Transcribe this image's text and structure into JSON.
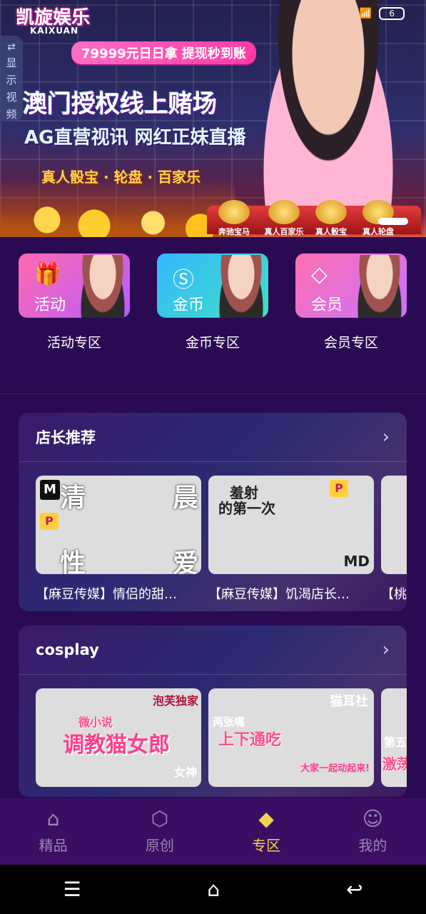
{
  "banner": {
    "brand": "凯旋娱乐",
    "brand_sub": "KAIXUAN",
    "status_battery": "6",
    "side_tab": [
      "显",
      "示",
      "视",
      "频"
    ],
    "ribbon": "79999元日日拿 提现秒到账",
    "headline1": "澳门授权线上赌场",
    "headline2": "AG直营视讯 网红正妹直播",
    "headline3": "真人骰宝 · 轮盘 · 百家乐",
    "games": [
      "奔驰宝马",
      "真人百家乐",
      "真人骰宝",
      "真人轮盘"
    ]
  },
  "categories": [
    {
      "card_label": "活动",
      "title": "活动专区",
      "icon": "gift-icon"
    },
    {
      "card_label": "金币",
      "title": "金币专区",
      "icon": "coin-icon"
    },
    {
      "card_label": "会员",
      "title": "会员专区",
      "icon": "diamond-icon"
    }
  ],
  "section1": {
    "title": "店长推荐",
    "videos": [
      {
        "caption": "【麻豆传媒】情侣的甜…",
        "overlay": [
          "清",
          "晨",
          "性",
          "爱"
        ]
      },
      {
        "caption": "【麻豆传媒】饥渴店长…",
        "overlay": [
          "羞射",
          "的第一次",
          "MD"
        ]
      },
      {
        "caption": "【桃",
        "overlay": []
      }
    ]
  },
  "section2": {
    "title": "cosplay",
    "videos": [
      {
        "caption": "",
        "overlay": [
          "泡芙独家",
          "调教猫女郎",
          "微小说",
          "女神"
        ]
      },
      {
        "caption": "",
        "overlay": [
          "猫耳社",
          "两张嘴",
          "上下通吃",
          "大家一起动起来!"
        ]
      },
      {
        "caption": "",
        "overlay": [
          "第五",
          "激荡"
        ]
      }
    ]
  },
  "tabbar": [
    {
      "label": "精品",
      "icon": "home-icon",
      "active": false
    },
    {
      "label": "原创",
      "icon": "cube-icon",
      "active": false
    },
    {
      "label": "专区",
      "icon": "diamond-icon",
      "active": true
    },
    {
      "label": "我的",
      "icon": "user-icon",
      "active": false
    }
  ],
  "colors": {
    "background": "#2a0a52",
    "tab_active": "#f5d24b",
    "tab_inactive": "#9a86b8"
  }
}
